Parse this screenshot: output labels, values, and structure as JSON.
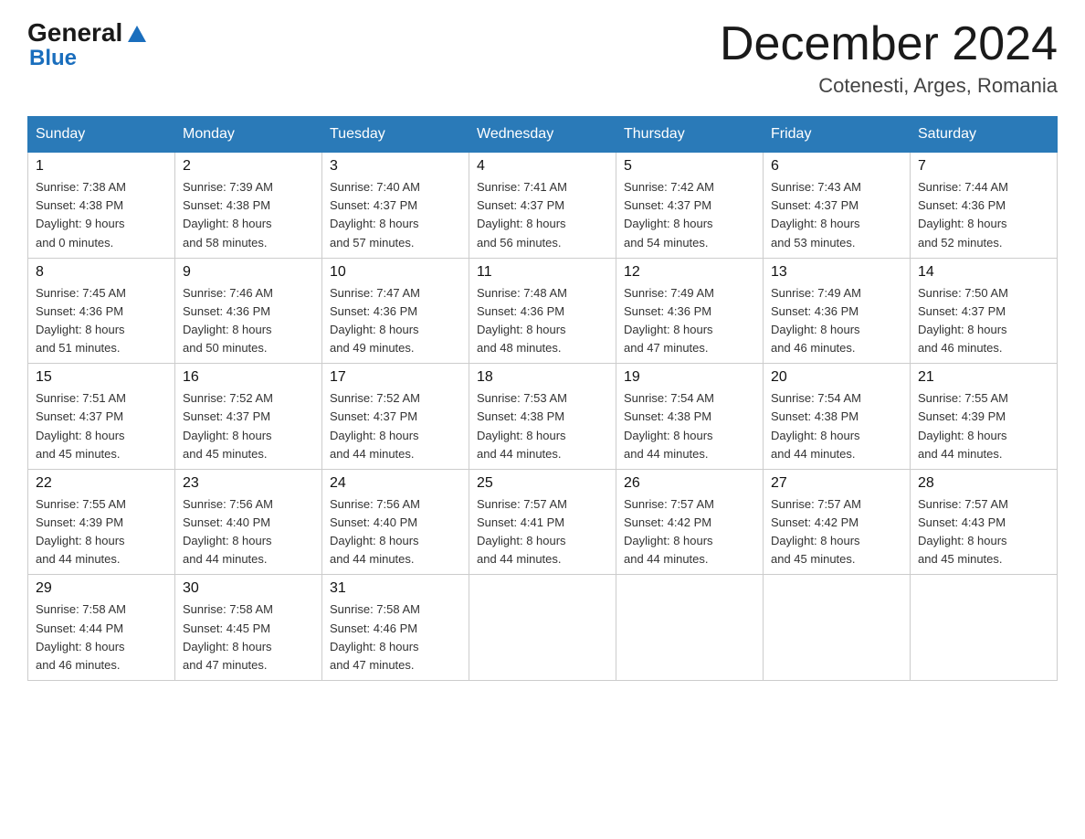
{
  "header": {
    "logo": {
      "general": "General",
      "blue": "Blue"
    },
    "title": "December 2024",
    "location": "Cotenesti, Arges, Romania"
  },
  "calendar": {
    "weekdays": [
      "Sunday",
      "Monday",
      "Tuesday",
      "Wednesday",
      "Thursday",
      "Friday",
      "Saturday"
    ],
    "weeks": [
      [
        {
          "day": "1",
          "sunrise": "7:38 AM",
          "sunset": "4:38 PM",
          "daylight_hours": "9 hours",
          "daylight_minutes": "0 minutes"
        },
        {
          "day": "2",
          "sunrise": "7:39 AM",
          "sunset": "4:38 PM",
          "daylight_hours": "8 hours",
          "daylight_minutes": "58 minutes"
        },
        {
          "day": "3",
          "sunrise": "7:40 AM",
          "sunset": "4:37 PM",
          "daylight_hours": "8 hours",
          "daylight_minutes": "57 minutes"
        },
        {
          "day": "4",
          "sunrise": "7:41 AM",
          "sunset": "4:37 PM",
          "daylight_hours": "8 hours",
          "daylight_minutes": "56 minutes"
        },
        {
          "day": "5",
          "sunrise": "7:42 AM",
          "sunset": "4:37 PM",
          "daylight_hours": "8 hours",
          "daylight_minutes": "54 minutes"
        },
        {
          "day": "6",
          "sunrise": "7:43 AM",
          "sunset": "4:37 PM",
          "daylight_hours": "8 hours",
          "daylight_minutes": "53 minutes"
        },
        {
          "day": "7",
          "sunrise": "7:44 AM",
          "sunset": "4:36 PM",
          "daylight_hours": "8 hours",
          "daylight_minutes": "52 minutes"
        }
      ],
      [
        {
          "day": "8",
          "sunrise": "7:45 AM",
          "sunset": "4:36 PM",
          "daylight_hours": "8 hours",
          "daylight_minutes": "51 minutes"
        },
        {
          "day": "9",
          "sunrise": "7:46 AM",
          "sunset": "4:36 PM",
          "daylight_hours": "8 hours",
          "daylight_minutes": "50 minutes"
        },
        {
          "day": "10",
          "sunrise": "7:47 AM",
          "sunset": "4:36 PM",
          "daylight_hours": "8 hours",
          "daylight_minutes": "49 minutes"
        },
        {
          "day": "11",
          "sunrise": "7:48 AM",
          "sunset": "4:36 PM",
          "daylight_hours": "8 hours",
          "daylight_minutes": "48 minutes"
        },
        {
          "day": "12",
          "sunrise": "7:49 AM",
          "sunset": "4:36 PM",
          "daylight_hours": "8 hours",
          "daylight_minutes": "47 minutes"
        },
        {
          "day": "13",
          "sunrise": "7:49 AM",
          "sunset": "4:36 PM",
          "daylight_hours": "8 hours",
          "daylight_minutes": "46 minutes"
        },
        {
          "day": "14",
          "sunrise": "7:50 AM",
          "sunset": "4:37 PM",
          "daylight_hours": "8 hours",
          "daylight_minutes": "46 minutes"
        }
      ],
      [
        {
          "day": "15",
          "sunrise": "7:51 AM",
          "sunset": "4:37 PM",
          "daylight_hours": "8 hours",
          "daylight_minutes": "45 minutes"
        },
        {
          "day": "16",
          "sunrise": "7:52 AM",
          "sunset": "4:37 PM",
          "daylight_hours": "8 hours",
          "daylight_minutes": "45 minutes"
        },
        {
          "day": "17",
          "sunrise": "7:52 AM",
          "sunset": "4:37 PM",
          "daylight_hours": "8 hours",
          "daylight_minutes": "44 minutes"
        },
        {
          "day": "18",
          "sunrise": "7:53 AM",
          "sunset": "4:38 PM",
          "daylight_hours": "8 hours",
          "daylight_minutes": "44 minutes"
        },
        {
          "day": "19",
          "sunrise": "7:54 AM",
          "sunset": "4:38 PM",
          "daylight_hours": "8 hours",
          "daylight_minutes": "44 minutes"
        },
        {
          "day": "20",
          "sunrise": "7:54 AM",
          "sunset": "4:38 PM",
          "daylight_hours": "8 hours",
          "daylight_minutes": "44 minutes"
        },
        {
          "day": "21",
          "sunrise": "7:55 AM",
          "sunset": "4:39 PM",
          "daylight_hours": "8 hours",
          "daylight_minutes": "44 minutes"
        }
      ],
      [
        {
          "day": "22",
          "sunrise": "7:55 AM",
          "sunset": "4:39 PM",
          "daylight_hours": "8 hours",
          "daylight_minutes": "44 minutes"
        },
        {
          "day": "23",
          "sunrise": "7:56 AM",
          "sunset": "4:40 PM",
          "daylight_hours": "8 hours",
          "daylight_minutes": "44 minutes"
        },
        {
          "day": "24",
          "sunrise": "7:56 AM",
          "sunset": "4:40 PM",
          "daylight_hours": "8 hours",
          "daylight_minutes": "44 minutes"
        },
        {
          "day": "25",
          "sunrise": "7:57 AM",
          "sunset": "4:41 PM",
          "daylight_hours": "8 hours",
          "daylight_minutes": "44 minutes"
        },
        {
          "day": "26",
          "sunrise": "7:57 AM",
          "sunset": "4:42 PM",
          "daylight_hours": "8 hours",
          "daylight_minutes": "44 minutes"
        },
        {
          "day": "27",
          "sunrise": "7:57 AM",
          "sunset": "4:42 PM",
          "daylight_hours": "8 hours",
          "daylight_minutes": "45 minutes"
        },
        {
          "day": "28",
          "sunrise": "7:57 AM",
          "sunset": "4:43 PM",
          "daylight_hours": "8 hours",
          "daylight_minutes": "45 minutes"
        }
      ],
      [
        {
          "day": "29",
          "sunrise": "7:58 AM",
          "sunset": "4:44 PM",
          "daylight_hours": "8 hours",
          "daylight_minutes": "46 minutes"
        },
        {
          "day": "30",
          "sunrise": "7:58 AM",
          "sunset": "4:45 PM",
          "daylight_hours": "8 hours",
          "daylight_minutes": "47 minutes"
        },
        {
          "day": "31",
          "sunrise": "7:58 AM",
          "sunset": "4:46 PM",
          "daylight_hours": "8 hours",
          "daylight_minutes": "47 minutes"
        },
        null,
        null,
        null,
        null
      ]
    ]
  },
  "labels": {
    "sunrise": "Sunrise:",
    "sunset": "Sunset:",
    "daylight": "Daylight:"
  }
}
